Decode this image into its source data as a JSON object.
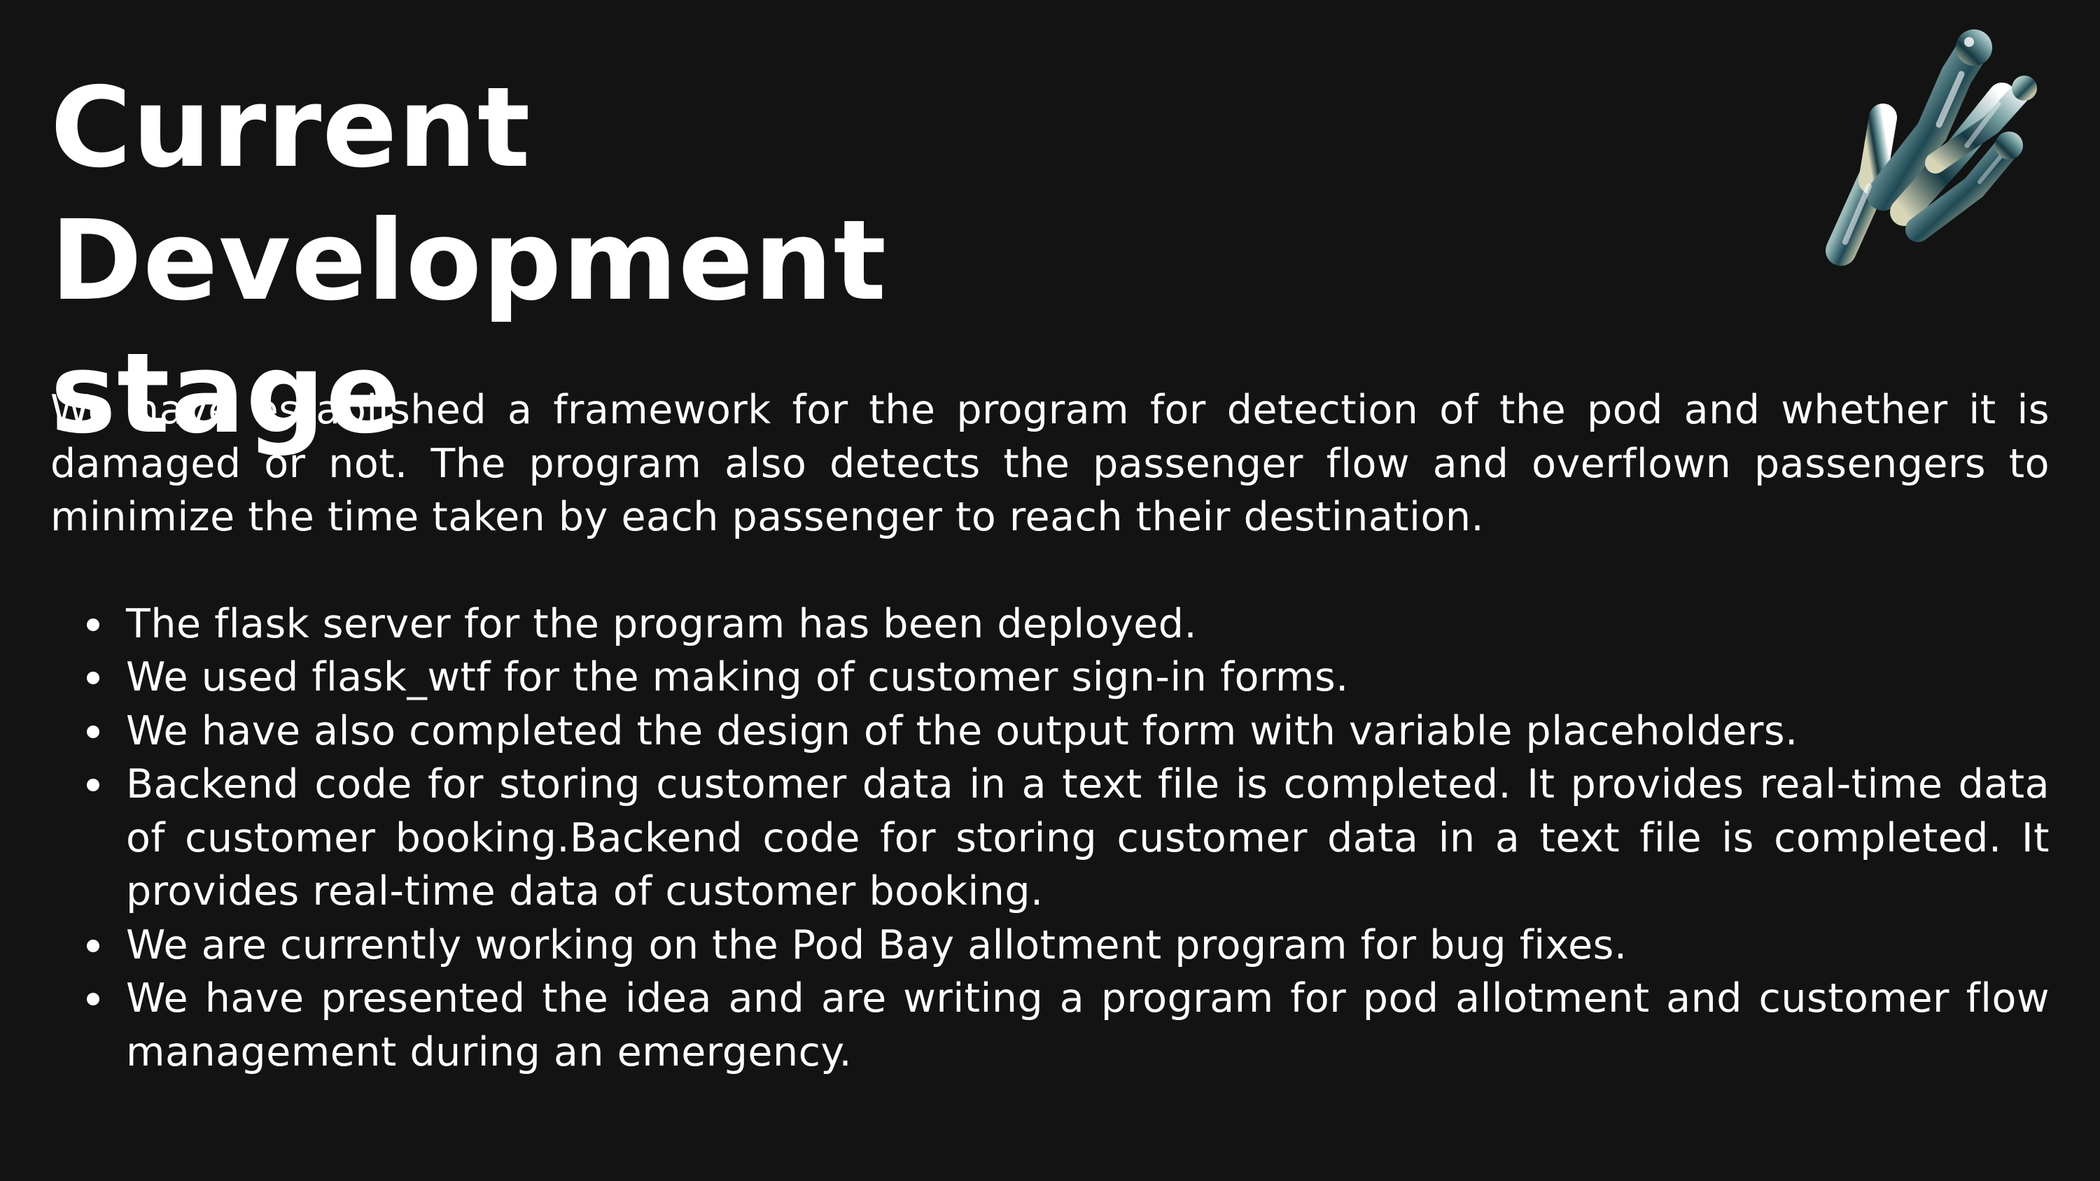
{
  "slide": {
    "title_line1": "Current Development",
    "title_line2": "stage",
    "intro": "We have established a framework for the program for detection of the pod and whether it is damaged or not. The program also detects the passenger flow and overflown passengers to minimize the time taken by each passenger to reach their destination.",
    "bullets": [
      "The flask server for the program has been deployed.",
      "We used flask_wtf for the making of customer sign-in forms.",
      "We have also completed the design of the output form with variable placeholders.",
      "Backend code for storing customer data in a text file is completed. It provides real-time data of customer booking.Backend code for storing customer data in a text file is completed. It provides real-time data of customer booking.",
      "We are currently working on the Pod Bay allotment program for bug fixes.",
      "We have presented the idea and are writing a program for pod allotment and customer flow management during an emergency."
    ],
    "logo_icon": "chrome-splash-icon"
  },
  "colors": {
    "background": "#131313",
    "text": "#ffffff"
  }
}
